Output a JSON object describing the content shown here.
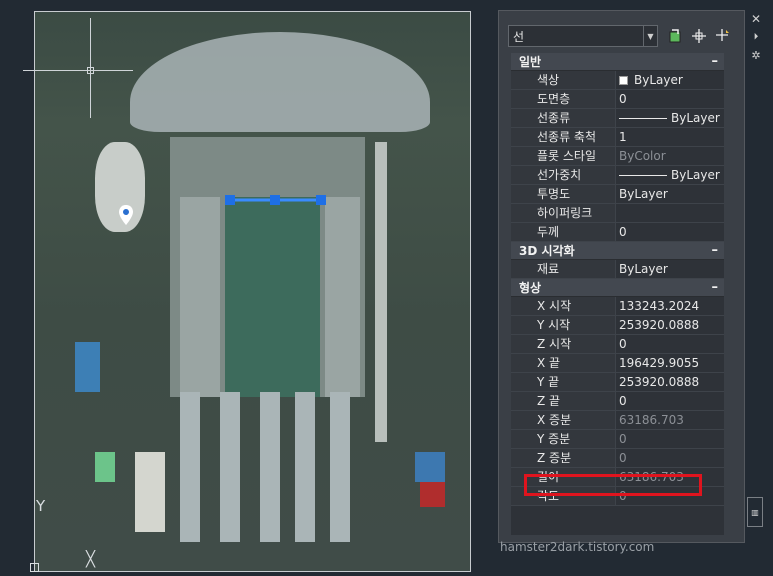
{
  "palette": {
    "selection": "선",
    "tools": [
      "toggle-pickadd-icon",
      "select-objects-icon",
      "quick-select-icon"
    ],
    "sections": [
      {
        "title": "일반",
        "toggle": "–",
        "rows": [
          {
            "label": "색상",
            "value": "ByLayer",
            "kind": "swatch"
          },
          {
            "label": "도면층",
            "value": "0"
          },
          {
            "label": "선종류",
            "value": "ByLayer",
            "kind": "line"
          },
          {
            "label": "선종류 축척",
            "value": "1"
          },
          {
            "label": "플롯 스타일",
            "value": "ByColor",
            "readonly": true
          },
          {
            "label": "선가중치",
            "value": "ByLayer",
            "kind": "line"
          },
          {
            "label": "투명도",
            "value": "ByLayer"
          },
          {
            "label": "하이퍼링크",
            "value": ""
          },
          {
            "label": "두께",
            "value": "0"
          }
        ]
      },
      {
        "title": "3D 시각화",
        "toggle": "–",
        "rows": [
          {
            "label": "재료",
            "value": "ByLayer"
          }
        ]
      },
      {
        "title": "형상",
        "toggle": "–",
        "rows": [
          {
            "label": "X 시작",
            "value": "133243.2024"
          },
          {
            "label": "Y 시작",
            "value": "253920.0888"
          },
          {
            "label": "Z 시작",
            "value": "0"
          },
          {
            "label": "X 끝",
            "value": "196429.9055"
          },
          {
            "label": "Y 끝",
            "value": "253920.0888"
          },
          {
            "label": "Z 끝",
            "value": "0"
          },
          {
            "label": "X 증분",
            "value": "63186.703",
            "readonly": true
          },
          {
            "label": "Y 증분",
            "value": "0",
            "readonly": true
          },
          {
            "label": "Z 증분",
            "value": "0",
            "readonly": true
          },
          {
            "label": "길이",
            "value": "63186.703",
            "readonly": true
          },
          {
            "label": "각도",
            "value": "0",
            "readonly": true
          }
        ]
      }
    ]
  },
  "canvas": {
    "ucs_y_label": "Y",
    "ucs_x_mark": "╳"
  },
  "watermark": "hamster2dark.tistory.com",
  "colors": {
    "highlight": "#e0141e",
    "grip": "#1e6fe6",
    "selected_line": "#3a8cff"
  }
}
